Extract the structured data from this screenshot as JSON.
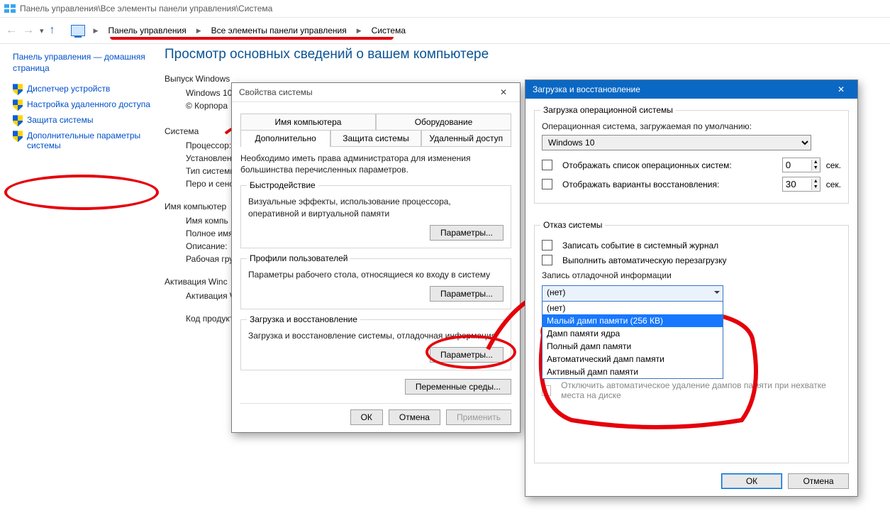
{
  "titlebar": "Панель управления\\Все элементы панели управления\\Система",
  "breadcrumbs": {
    "root": "Панель управления",
    "mid": "Все элементы панели управления",
    "leaf": "Система"
  },
  "sidebar": {
    "home": "Панель управления — домашняя страница",
    "items": [
      "Диспетчер устройств",
      "Настройка удаленного доступа",
      "Защита системы",
      "Дополнительные параметры системы"
    ]
  },
  "content": {
    "heading": "Просмотр основных сведений о вашем компьютере",
    "sec_edition": "Выпуск Windows",
    "edition_line1": "Windows 10",
    "edition_line2": "© Корпора",
    "sec_system": "Система",
    "sys_proc": "Процессор:",
    "sys_ram": "Установленн(ОЗУ):",
    "sys_type": "Тип системы",
    "sys_pen": "Перо и сенс",
    "sec_name": "Имя компьютер",
    "name_comp": "Имя компь",
    "name_full": "Полное имя",
    "name_desc": "Описание:",
    "name_group": "Рабочая гру",
    "sec_act": "Активация Winc",
    "act_line": "Активация W",
    "prod_code": "Код продукт"
  },
  "sysprops": {
    "title": "Свойства системы",
    "tabs": {
      "computer_name": "Имя компьютера",
      "hardware": "Оборудование",
      "advanced": "Дополнительно",
      "protection": "Защита системы",
      "remote": "Удаленный доступ"
    },
    "hint": "Необходимо иметь права администратора для изменения большинства перечисленных параметров.",
    "perf_title": "Быстродействие",
    "perf_text": "Визуальные эффекты, использование процессора, оперативной и виртуальной памяти",
    "profiles_title": "Профили пользователей",
    "profiles_text": "Параметры рабочего стола, относящиеся ко входу в систему",
    "startup_title": "Загрузка и восстановление",
    "startup_text": "Загрузка и восстановление системы, отладочная информация",
    "btn_params": "Параметры...",
    "btn_envvars": "Переменные среды...",
    "btn_ok": "ОК",
    "btn_cancel": "Отмена",
    "btn_apply": "Применить"
  },
  "startup": {
    "title": "Загрузка и восстановление",
    "sec_boot": "Загрузка операционной системы",
    "default_os_label": "Операционная система, загружаемая по умолчанию:",
    "default_os_value": "Windows 10",
    "chk_oslist": "Отображать список операционных систем:",
    "chk_recovery": "Отображать варианты восстановления:",
    "secs": "сек.",
    "oslist_val": "0",
    "recovery_val": "30",
    "sec_fail": "Отказ системы",
    "chk_log": "Записать событие в системный журнал",
    "chk_restart": "Выполнить автоматическую перезагрузку",
    "dump_label": "Запись отладочной информации",
    "dump_selected": "(нет)",
    "dump_options": [
      "(нет)",
      "Малый дамп памяти (256 КВ)",
      "Дамп памяти ядра",
      "Полный дамп памяти",
      "Автоматический дамп памяти",
      "Активный дамп памяти"
    ],
    "dump_highlight_index": 1,
    "chk_nodelete_partial": "Отключить автоматическое удаление дампов памяти при нехватке места на диске",
    "btn_ok": "ОК",
    "btn_cancel": "Отмена"
  }
}
